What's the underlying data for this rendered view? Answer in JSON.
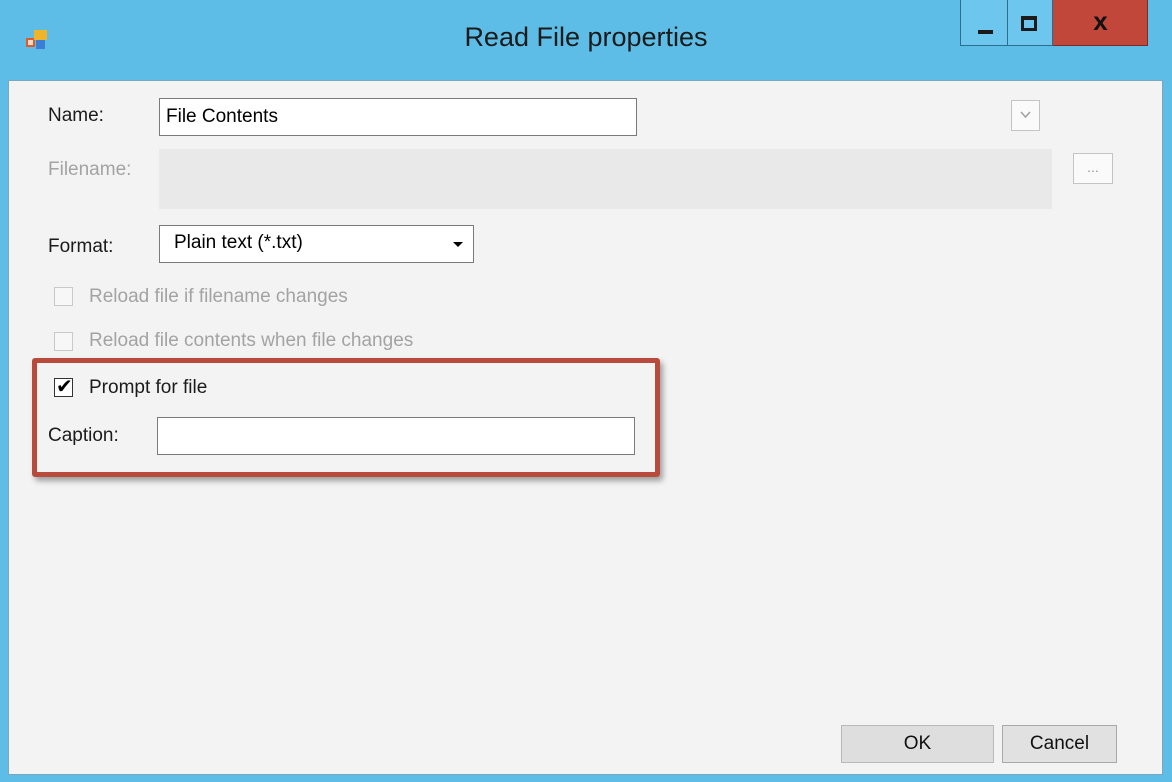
{
  "window": {
    "title": "Read File properties",
    "app_icon": "app-icon",
    "controls": {
      "minimize_icon": "minimize-icon",
      "maximize_icon": "maximize-icon",
      "close_label": "x"
    }
  },
  "form": {
    "name": {
      "label": "Name:",
      "value": "File Contents",
      "dropdown_icon": "chevron-down-icon"
    },
    "filename": {
      "label": "Filename:",
      "value": "",
      "browse_label": "..."
    },
    "format": {
      "label": "Format:",
      "selected": "Plain text (*.txt)"
    },
    "reload_filename": {
      "label": "Reload file if filename changes",
      "checked": false,
      "enabled": false
    },
    "reload_contents": {
      "label": "Reload file contents when file changes",
      "checked": false,
      "enabled": false
    },
    "prompt_for_file": {
      "label": "Prompt for file",
      "checked": true,
      "enabled": true
    },
    "caption": {
      "label": "Caption:",
      "value": ""
    }
  },
  "buttons": {
    "ok": "OK",
    "cancel": "Cancel"
  },
  "colors": {
    "titlebar": "#5dbde6",
    "close_button": "#c0473a",
    "highlight_border": "#b84b3c",
    "client_bg": "#f3f3f3"
  }
}
